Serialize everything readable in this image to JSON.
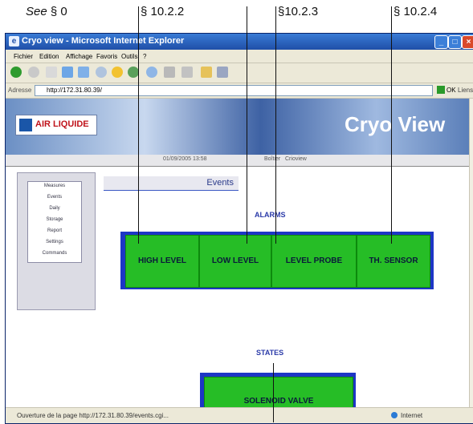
{
  "callouts": {
    "see_prefix": "See",
    "see_ref": "§ 0",
    "ref1": "§ 10.2.2",
    "ref2": "§10.2.3",
    "ref3": "§ 10.2.4"
  },
  "window": {
    "title": "Cryo view - Microsoft Internet Explorer",
    "menu": [
      "Fichier",
      "Edition",
      "Affichage",
      "Favoris",
      "Outils",
      "?"
    ],
    "address_label": "Adresse",
    "address_url": "http://172.31.80.39/",
    "go_label": "OK",
    "links_label": "Liens"
  },
  "banner": {
    "logo_text": "AIR LIQUIDE",
    "brand": "Cryo View"
  },
  "tabstrip": {
    "datetime": "01/09/2005 13:58",
    "box_label": "Boîtier",
    "box_value": "Crioview"
  },
  "sidebar": {
    "items": [
      "Measures",
      "Events",
      "Daily",
      "Storage",
      "Report",
      "Settings",
      "Commands"
    ]
  },
  "events_header": "Events",
  "alarms": {
    "title": "ALARMS",
    "items": [
      "HIGH LEVEL",
      "LOW LEVEL",
      "LEVEL PROBE",
      "TH. SENSOR"
    ]
  },
  "states": {
    "title": "STATES",
    "items": [
      "SOLENOID VALVE"
    ]
  },
  "status": {
    "message": "Ouverture de la page http://172.31.80.39/events.cgi...",
    "zone": "Internet"
  },
  "colors": {
    "alarm_frame": "#1d36c6",
    "alarm_cell": "#26bd26",
    "titlebar": "#1f4fa8"
  }
}
